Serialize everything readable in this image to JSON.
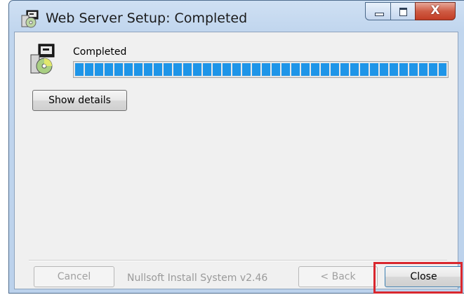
{
  "window": {
    "title": "Web Server Setup: Completed",
    "controls": {
      "minimize": "minimize",
      "maximize": "maximize",
      "close": "X"
    }
  },
  "status": {
    "text": "Completed",
    "progress_percent": 100
  },
  "buttons": {
    "show_details": "Show details",
    "cancel": "Cancel",
    "back": "< Back",
    "close": "Close"
  },
  "branding": "Nullsoft Install System v2.46",
  "colors": {
    "progress_fill": "#1e95e8",
    "highlight": "#d9272e",
    "close_button_chrome": "#c23d25"
  },
  "icons": [
    "installer-icon",
    "minimize-icon",
    "maximize-icon",
    "close-icon",
    "progress-installer-icon"
  ]
}
